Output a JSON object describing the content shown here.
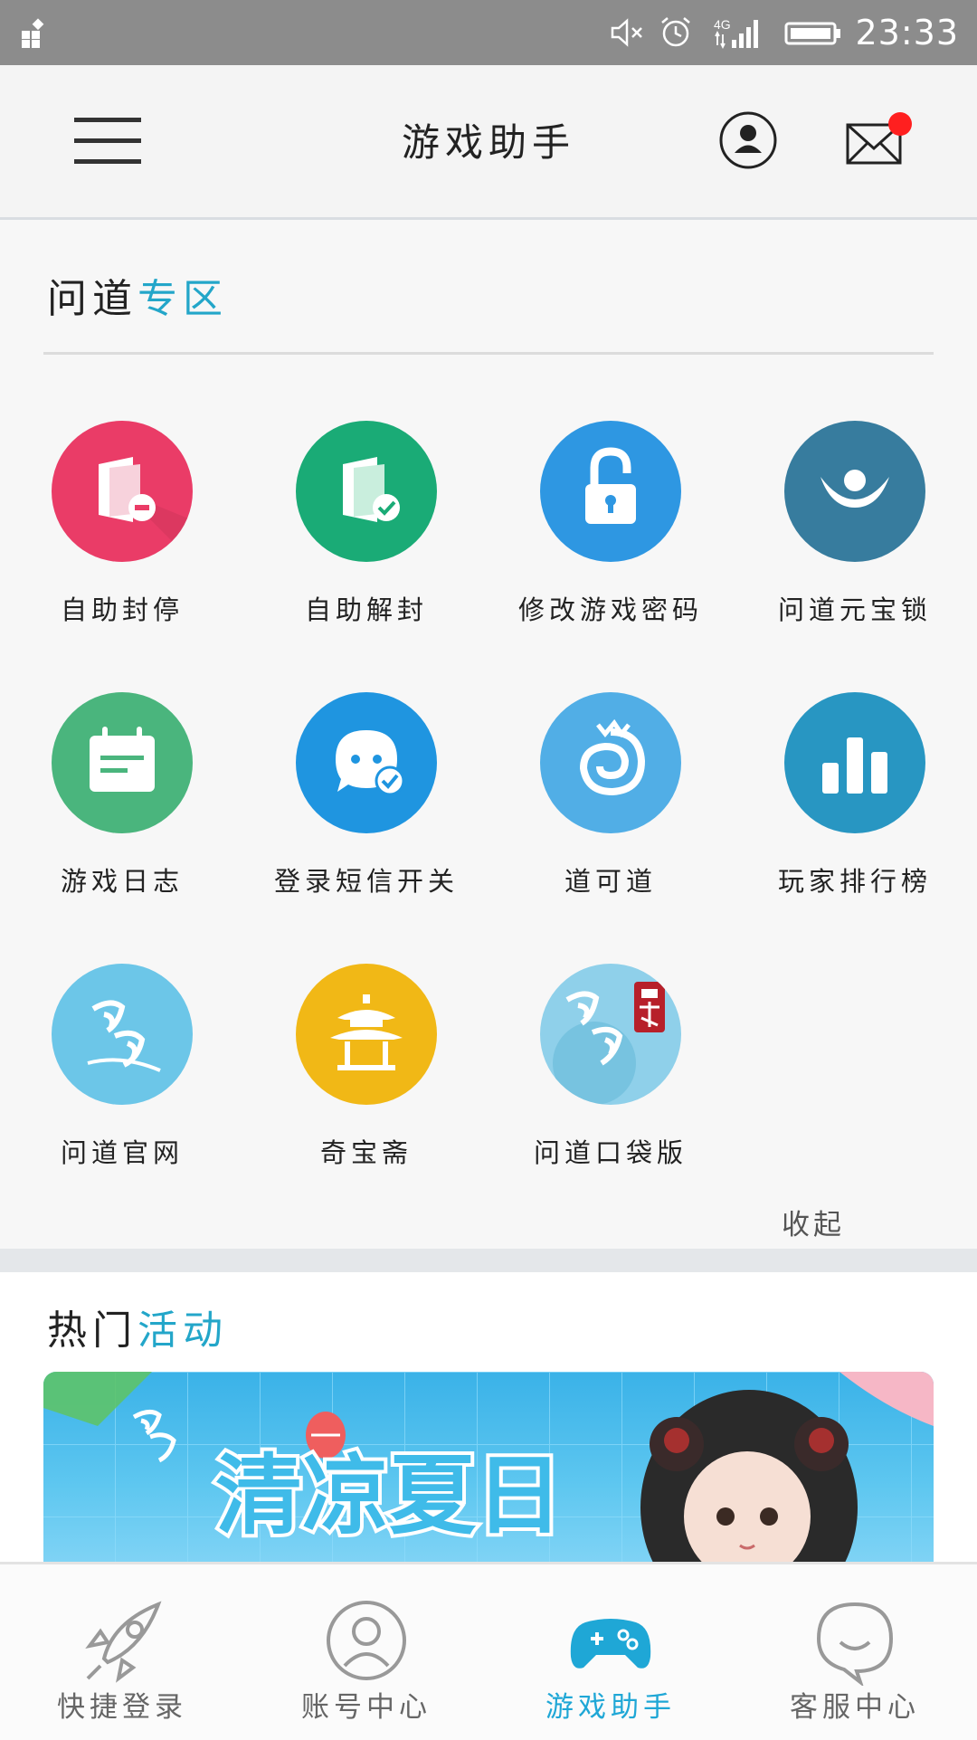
{
  "status_bar": {
    "time": "23:33",
    "network": "4G",
    "icons": [
      "app-grid-icon",
      "mute-icon",
      "alarm-icon",
      "signal-icon",
      "battery-icon"
    ]
  },
  "header": {
    "title": "游戏助手",
    "icons": [
      "menu-icon",
      "user-icon",
      "mail-icon"
    ],
    "has_notification": true
  },
  "wendao_section": {
    "title_main": "问道",
    "title_accent": "专区",
    "items": [
      {
        "label": "自助封停",
        "icon": "folder-block-icon",
        "color": "#ea3c67"
      },
      {
        "label": "自助解封",
        "icon": "folder-check-icon",
        "color": "#1aab76"
      },
      {
        "label": "修改游戏密码",
        "icon": "lock-open-icon",
        "color": "#2e97e2"
      },
      {
        "label": "问道元宝锁",
        "icon": "ingot-lock-icon",
        "color": "#377c9e"
      },
      {
        "label": "游戏日志",
        "icon": "calendar-icon",
        "color": "#4ab57d"
      },
      {
        "label": "登录短信开关",
        "icon": "chat-check-icon",
        "color": "#1f95e0"
      },
      {
        "label": "道可道",
        "icon": "swirl-logo-icon",
        "color": "#51aee6"
      },
      {
        "label": "玩家排行榜",
        "icon": "bar-chart-icon",
        "color": "#2896c2"
      },
      {
        "label": "问道官网",
        "icon": "wendao-logo-icon",
        "color": "#6cc6e8"
      },
      {
        "label": "奇宝斋",
        "icon": "pavilion-icon",
        "color": "#f1b816"
      },
      {
        "label": "问道口袋版",
        "icon": "wendao-pocket-logo-icon",
        "color": "#8fd0ea"
      }
    ],
    "collapse_label": "收起"
  },
  "hot_section": {
    "title_main": "热门",
    "title_accent": "活动",
    "banner_text": "清凉夏日"
  },
  "bottom_nav": {
    "items": [
      {
        "label": "快捷登录",
        "icon": "rocket-icon",
        "active": false
      },
      {
        "label": "账号中心",
        "icon": "account-icon",
        "active": false
      },
      {
        "label": "游戏助手",
        "icon": "gamepad-icon",
        "active": true
      },
      {
        "label": "客服中心",
        "icon": "chat-bubble-icon",
        "active": false
      }
    ],
    "accent_color": "#1fa7d6"
  }
}
